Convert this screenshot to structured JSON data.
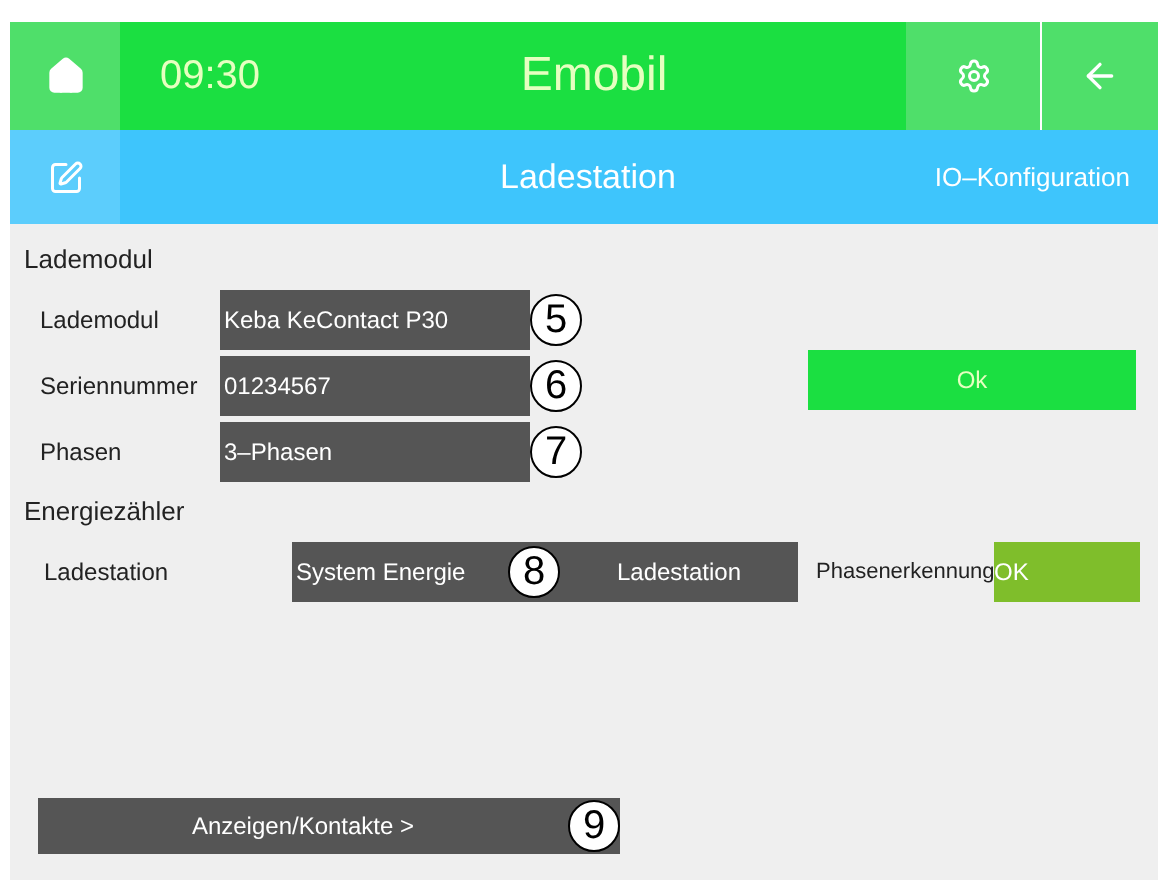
{
  "header": {
    "time": "09:30",
    "title": "Emobil"
  },
  "subheader": {
    "title": "Ladestation",
    "link": "IO–Konfiguration"
  },
  "lademodul": {
    "heading": "Lademodul",
    "fields": [
      {
        "label": "Lademodul",
        "value": "Keba KeContact P30",
        "callout": "5"
      },
      {
        "label": "Seriennummer",
        "value": "01234567",
        "callout": "6"
      },
      {
        "label": "Phasen",
        "value": "3–Phasen",
        "callout": "7"
      }
    ],
    "ok_button": "Ok"
  },
  "energiezaehler": {
    "heading": "Energiezähler",
    "label": "Ladestation",
    "segments": [
      "System Energie",
      "Ladestation"
    ],
    "callout": "8",
    "phase_label": "Phasenerkennung",
    "phase_status": {
      "text": "OK",
      "color": "#7fbe2b"
    }
  },
  "contacts_button": {
    "label": "Anzeigen/Kontakte >",
    "callout": "9"
  }
}
